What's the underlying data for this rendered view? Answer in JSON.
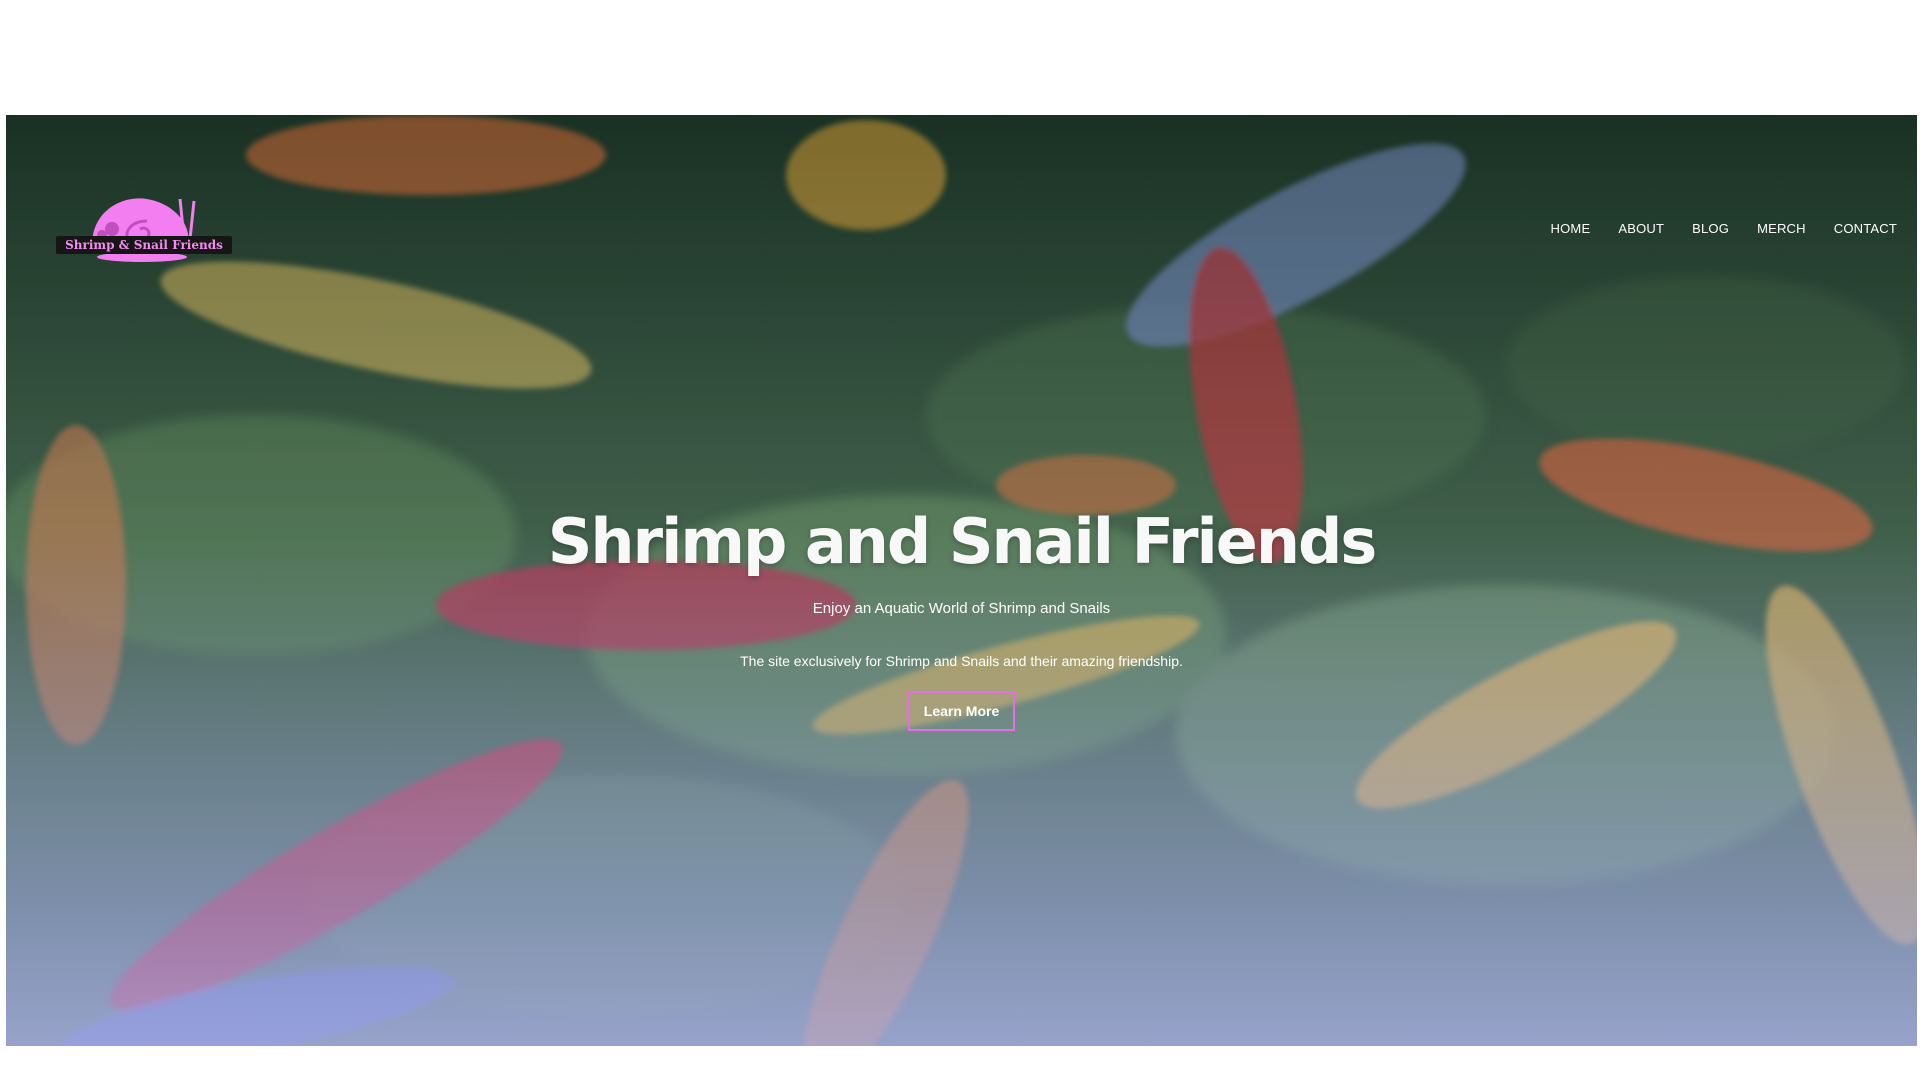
{
  "logo": {
    "text": "Shrimp & Snail Friends",
    "colors": {
      "shell": "#f27ef0",
      "shell_dark": "#c24fbf",
      "banner": "#161616"
    }
  },
  "nav": {
    "items": [
      {
        "label": "HOME"
      },
      {
        "label": "ABOUT"
      },
      {
        "label": "BLOG"
      },
      {
        "label": "MERCH"
      },
      {
        "label": "CONTACT"
      }
    ]
  },
  "hero": {
    "title": "Shrimp and Snail Friends",
    "tagline": "Enjoy an Aquatic World of Shrimp and Snails",
    "description": "The site exclusively for Shrimp and Snails and their amazing friendship.",
    "cta_label": "Learn More",
    "background": "aquarium-shrimp-photo",
    "colors": {
      "cta_border": "#e56ee8",
      "overlay": "#a7aaf0"
    }
  }
}
